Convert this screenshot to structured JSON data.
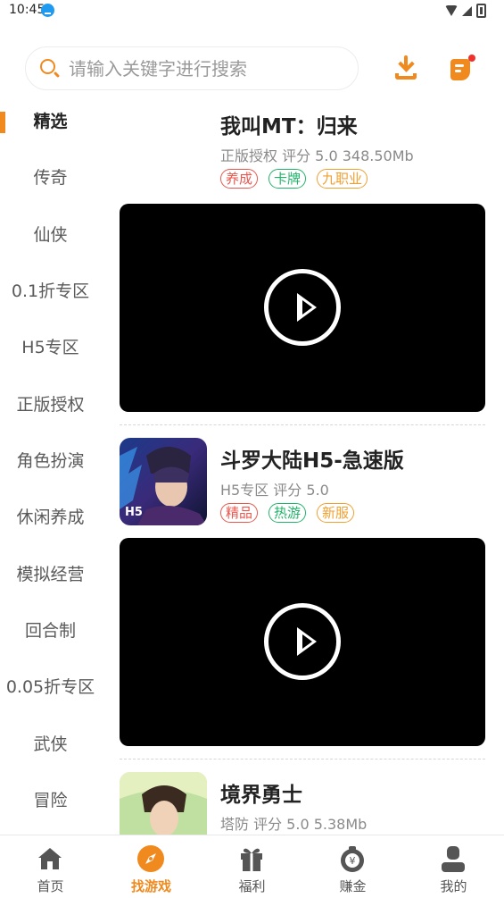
{
  "status": {
    "time": "10:45"
  },
  "search": {
    "placeholder": "请输入关键字进行搜索"
  },
  "sidebar": {
    "items": [
      {
        "label": "精选",
        "active": true
      },
      {
        "label": "传奇"
      },
      {
        "label": "仙侠"
      },
      {
        "label": "0.1折专区"
      },
      {
        "label": "H5专区"
      },
      {
        "label": "正版授权"
      },
      {
        "label": "角色扮演"
      },
      {
        "label": "休闲养成"
      },
      {
        "label": "模拟经营"
      },
      {
        "label": "回合制"
      },
      {
        "label": "0.05折专区"
      },
      {
        "label": "武侠"
      },
      {
        "label": "冒险"
      }
    ]
  },
  "games": [
    {
      "title": "我叫MT：归来",
      "meta": "正版授权  评分 5.0   348.50Mb",
      "tags": [
        {
          "label": "养成",
          "color": "#e8574e"
        },
        {
          "label": "卡牌",
          "color": "#22b36a"
        },
        {
          "label": "九职业",
          "color": "#f0a030"
        }
      ]
    },
    {
      "title": "斗罗大陆H5-急速版",
      "meta": "H5专区  评分 5.0",
      "thumb_label": "H5",
      "tags": [
        {
          "label": "精品",
          "color": "#e8574e"
        },
        {
          "label": "热游",
          "color": "#22b36a"
        },
        {
          "label": "新服",
          "color": "#f0a030"
        }
      ]
    },
    {
      "title": "境界勇士",
      "meta": "塔防  评分 5.0   5.38Mb",
      "tags": []
    }
  ],
  "bottom_nav": [
    {
      "label": "首页",
      "icon": "home-icon"
    },
    {
      "label": "找游戏",
      "icon": "compass-icon",
      "active": true
    },
    {
      "label": "福利",
      "icon": "gift-icon"
    },
    {
      "label": "赚金",
      "icon": "money-bag-icon"
    },
    {
      "label": "我的",
      "icon": "user-icon"
    }
  ],
  "colors": {
    "accent": "#f08a1e",
    "tag_red": "#e8574e",
    "tag_green": "#22b36a",
    "tag_orange": "#f0a030"
  }
}
